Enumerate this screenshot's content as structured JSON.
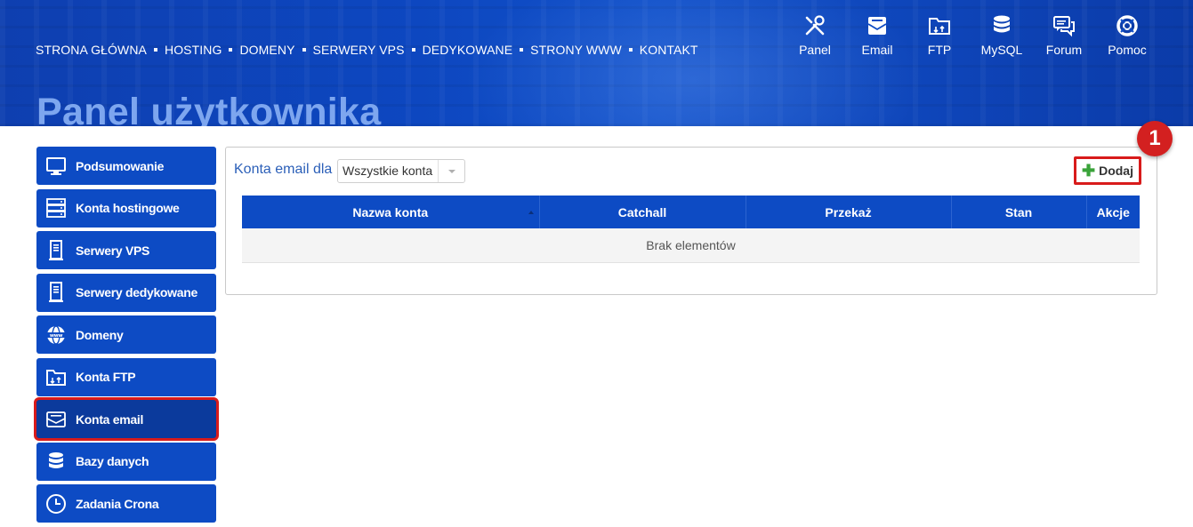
{
  "header": {
    "nav": [
      "STRONA GŁÓWNA",
      "HOSTING",
      "DOMENY",
      "SERWERY VPS",
      "DEDYKOWANE",
      "STRONY WWW",
      "KONTAKT"
    ],
    "quick_links": [
      {
        "label": "Panel",
        "icon": "tools-icon"
      },
      {
        "label": "Email",
        "icon": "email-icon"
      },
      {
        "label": "FTP",
        "icon": "ftp-folder-icon"
      },
      {
        "label": "MySQL",
        "icon": "database-icon"
      },
      {
        "label": "Forum",
        "icon": "forum-icon"
      },
      {
        "label": "Pomoc",
        "icon": "lifebuoy-icon"
      }
    ],
    "page_title": "Panel użytkownika"
  },
  "sidebar": {
    "items": [
      {
        "label": "Podsumowanie",
        "icon": "monitor-icon"
      },
      {
        "label": "Konta hostingowe",
        "icon": "server-rack-icon"
      },
      {
        "label": "Serwery VPS",
        "icon": "server-icon"
      },
      {
        "label": "Serwery dedykowane",
        "icon": "server-icon"
      },
      {
        "label": "Domeny",
        "icon": "www-globe-icon"
      },
      {
        "label": "Konta FTP",
        "icon": "ftp-folder-icon"
      },
      {
        "label": "Konta email",
        "icon": "email-icon",
        "active": true
      },
      {
        "label": "Bazy danych",
        "icon": "database-icon"
      },
      {
        "label": "Zadania Crona",
        "icon": "clock-icon"
      }
    ]
  },
  "main": {
    "filter_label": "Konta email dla",
    "filter_value": "Wszystkie konta",
    "add_button": "Dodaj",
    "annotation_badge": "1",
    "table": {
      "columns": [
        "Nazwa konta",
        "Catchall",
        "Przekaż",
        "Stan",
        "Akcje"
      ],
      "empty_text": "Brak elementów"
    }
  },
  "colors": {
    "primary": "#0d4bc4",
    "highlight": "#d81b1b",
    "title": "#7da6ef",
    "add_icon": "#3aa33a"
  }
}
